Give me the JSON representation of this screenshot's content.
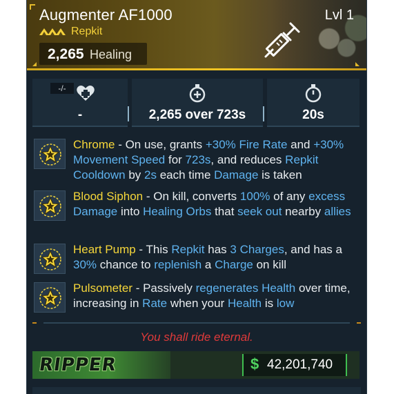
{
  "item": {
    "name": "Augmenter AF1000",
    "level": "Lvl 1",
    "type": "Repkit",
    "rarity_icon": "triple-chevron-rarity-icon",
    "primary_stat_value": "2,265",
    "primary_stat_label": "Healing"
  },
  "stats": [
    {
      "icon": "heart-plus-icon",
      "tag": "-/-",
      "value": "-"
    },
    {
      "icon": "stopwatch-plus-icon",
      "value": "2,265 over 723s"
    },
    {
      "icon": "stopwatch-icon",
      "value": "20s"
    }
  ],
  "perks": [
    {
      "name": "Chrome",
      "segments": [
        {
          "t": " - On use, grants ",
          "h": false
        },
        {
          "t": "+30% Fire Rate",
          "h": true
        },
        {
          "t": " and ",
          "h": false
        },
        {
          "t": "+30% Movement Speed",
          "h": true
        },
        {
          "t": " for ",
          "h": false
        },
        {
          "t": "723s",
          "h": true
        },
        {
          "t": ", and reduces ",
          "h": false
        },
        {
          "t": "Repkit Cooldown",
          "h": true
        },
        {
          "t": " by ",
          "h": false
        },
        {
          "t": "2s",
          "h": true
        },
        {
          "t": " each time ",
          "h": false
        },
        {
          "t": "Damage",
          "h": true
        },
        {
          "t": " is taken",
          "h": false
        }
      ]
    },
    {
      "name": "Blood Siphon",
      "segments": [
        {
          "t": " - On kill, converts ",
          "h": false
        },
        {
          "t": "100%",
          "h": true
        },
        {
          "t": " of any ",
          "h": false
        },
        {
          "t": "excess Damage",
          "h": true
        },
        {
          "t": " into ",
          "h": false
        },
        {
          "t": "Healing Orbs",
          "h": true
        },
        {
          "t": " that ",
          "h": false
        },
        {
          "t": "seek out",
          "h": true
        },
        {
          "t": " nearby ",
          "h": false
        },
        {
          "t": "allies",
          "h": true
        }
      ]
    },
    {
      "name": "Heart Pump",
      "segments": [
        {
          "t": " - This ",
          "h": false
        },
        {
          "t": "Repkit",
          "h": true
        },
        {
          "t": " has ",
          "h": false
        },
        {
          "t": "3 Charges",
          "h": true
        },
        {
          "t": ", and has a ",
          "h": false
        },
        {
          "t": "30%",
          "h": true
        },
        {
          "t": " chance to ",
          "h": false
        },
        {
          "t": "replenish",
          "h": true
        },
        {
          "t": " a ",
          "h": false
        },
        {
          "t": "Charge",
          "h": true
        },
        {
          "t": " on kill",
          "h": false
        }
      ]
    },
    {
      "name": "Pulsometer",
      "segments": [
        {
          "t": " - Passively ",
          "h": false
        },
        {
          "t": "regenerates Health",
          "h": true
        },
        {
          "t": " over time, increasing in ",
          "h": false
        },
        {
          "t": "Rate",
          "h": true
        },
        {
          "t": " when your ",
          "h": false
        },
        {
          "t": "Health",
          "h": true
        },
        {
          "t": " is ",
          "h": false
        },
        {
          "t": "low",
          "h": true
        }
      ]
    }
  ],
  "flavor_text": "You shall ride eternal.",
  "manufacturer": {
    "logo_text": "RIPPER",
    "logo_icon": "ripper-manufacturer-logo"
  },
  "price": {
    "icon": "dollar-icon",
    "symbol": "$",
    "value": "42,201,740"
  },
  "colors": {
    "name_text": "#ffffff",
    "rarity_accent": "#f4d13a",
    "perk_name": "#f5d63a",
    "highlight": "#5fb3ef",
    "flavor": "#e03a3a",
    "price_accent": "#3fbf4f"
  }
}
